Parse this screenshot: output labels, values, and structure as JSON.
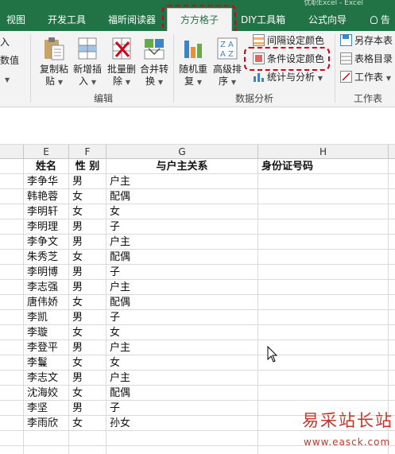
{
  "title_fragment": "优职Excel - Excel",
  "tabs": [
    {
      "label": "视图"
    },
    {
      "label": "开发工具"
    },
    {
      "label": "福昕阅读器"
    },
    {
      "label": "方方格子"
    },
    {
      "label": "DIY工具箱"
    },
    {
      "label": "公式向导"
    },
    {
      "label": "告"
    }
  ],
  "ribbon": {
    "partial_left_1": "插入",
    "partial_left_2": "留数值",
    "copy_paste": {
      "line1": "复制粘",
      "line2": "贴"
    },
    "add_insert": {
      "line1": "新增插",
      "line2": "入"
    },
    "batch_delete": {
      "line1": "批量删",
      "line2": "除"
    },
    "merge_convert": {
      "line1": "合并转",
      "line2": "换"
    },
    "group_edit": "编辑",
    "random_reorder": {
      "line1": "随机重",
      "line2": "复"
    },
    "advanced_sort": {
      "line1": "高级排",
      "line2": "序"
    },
    "interval_color": "间隔设定颜色",
    "condition_color": "条件设定颜色",
    "stats_analysis": "统计与分析",
    "group_data_analysis": "数据分析",
    "save_as": "另存本表",
    "sheet_dir": "表格目录",
    "worksheet": "工作表",
    "group_worksheet": "工作表"
  },
  "columns": [
    "E",
    "F",
    "G",
    "H"
  ],
  "table": {
    "headers": [
      "姓名",
      "性 别",
      "与户主关系",
      "身份证号码"
    ],
    "rows": [
      [
        "李争华",
        "男",
        "户主"
      ],
      [
        "韩艳蓉",
        "女",
        "配偶"
      ],
      [
        "李明轩",
        "女",
        "女"
      ],
      [
        "李明理",
        "男",
        "子"
      ],
      [
        "李争文",
        "男",
        "户主"
      ],
      [
        "朱秀芝",
        "女",
        "配偶"
      ],
      [
        "李明博",
        "男",
        "子"
      ],
      [
        "李志强",
        "男",
        "户主"
      ],
      [
        "唐伟娇",
        "女",
        "配偶"
      ],
      [
        "李凯",
        "男",
        "子"
      ],
      [
        "李璇",
        "女",
        "女"
      ],
      [
        "李登平",
        "男",
        "户主"
      ],
      [
        "李鬘",
        "女",
        "女"
      ],
      [
        "李志文",
        "男",
        "户主"
      ],
      [
        "沈海姣",
        "女",
        "配偶"
      ],
      [
        "李坚",
        "男",
        "子"
      ],
      [
        "李雨欣",
        "女",
        "孙女"
      ]
    ]
  },
  "watermark": {
    "logo": "易采站长站",
    "url": "www.easck.com"
  },
  "colors": {
    "ribbon_green": "#217346",
    "highlight_red": "#d0021b"
  }
}
